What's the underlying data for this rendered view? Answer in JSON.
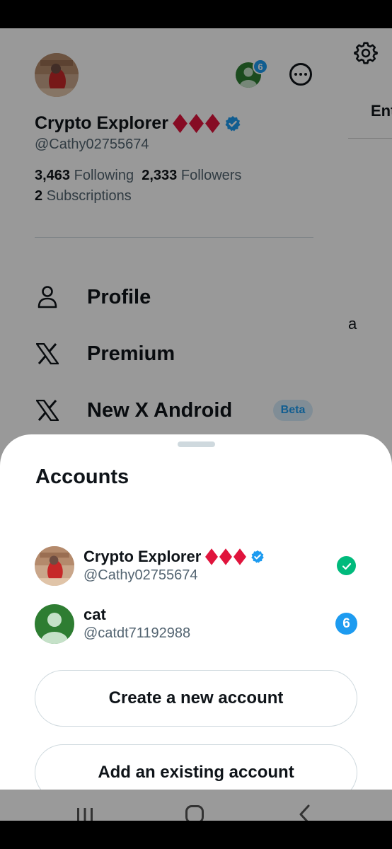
{
  "drawer": {
    "display_name": "Crypto Explorer",
    "handle": "@Cathy02755674",
    "following_count": "3,463",
    "following_label": "Following",
    "followers_count": "2,333",
    "followers_label": "Followers",
    "subscriptions_count": "2",
    "subscriptions_label": "Subscriptions",
    "switch_account_badge": "6",
    "menu": [
      {
        "label": "Profile",
        "icon": "person-icon"
      },
      {
        "label": "Premium",
        "icon": "x-logo-icon"
      },
      {
        "label": "New X Android",
        "icon": "x-logo-icon",
        "badge": "Beta"
      }
    ]
  },
  "background": {
    "tab_partial": "Ent",
    "text_partial": "a"
  },
  "sheet": {
    "title": "Accounts",
    "accounts": [
      {
        "name": "Crypto Explorer",
        "handle": "@Cathy02755674",
        "status": "active"
      },
      {
        "name": "cat",
        "handle": "@catdt71192988",
        "notifications": "6"
      }
    ],
    "create_button": "Create a new account",
    "add_button": "Add an existing account"
  },
  "colors": {
    "accent_blue": "#1d9bf0",
    "success_green": "#00ba7c",
    "diamond_red": "#e0143c",
    "default_avatar_green": "#2e7d32"
  }
}
